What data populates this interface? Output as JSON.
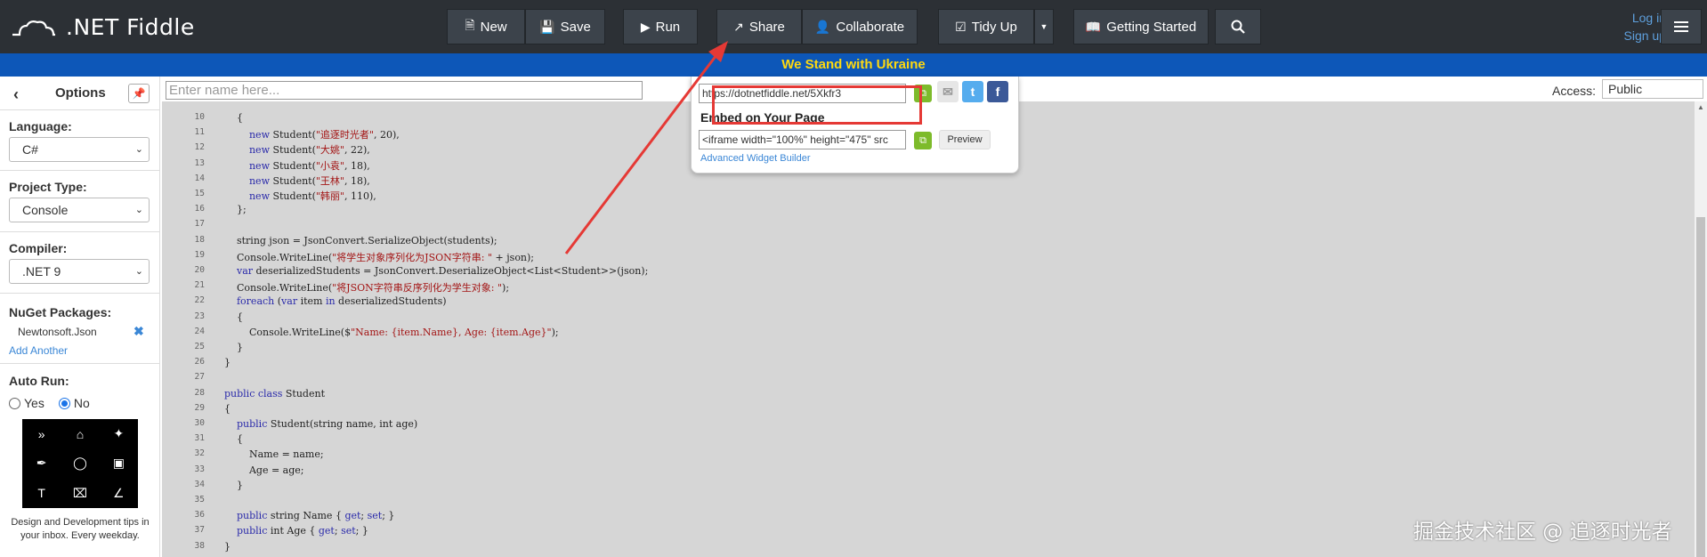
{
  "app": {
    "logo_text": ".NET Fiddle"
  },
  "toolbar": {
    "new_label": "New",
    "save_label": "Save",
    "run_label": "Run",
    "share_label": "Share",
    "collaborate_label": "Collaborate",
    "tidy_label": "Tidy Up",
    "getting_started_label": "Getting Started"
  },
  "auth": {
    "login": "Log in",
    "signup": "Sign up"
  },
  "banner": {
    "text": "We Stand with Ukraine"
  },
  "sidebar": {
    "title": "Options",
    "language_label": "Language:",
    "language_value": "C#",
    "project_type_label": "Project Type:",
    "project_type_value": "Console",
    "compiler_label": "Compiler:",
    "compiler_value": ".NET 9",
    "nuget_label": "NuGet Packages:",
    "nuget_items": [
      "Newtonsoft.Json"
    ],
    "add_another": "Add Another",
    "autorun_label": "Auto Run:",
    "autorun_yes": "Yes",
    "autorun_no": "No",
    "autorun_selected": "No",
    "ad_text": "Design and Development tips in your inbox. Every weekday."
  },
  "main": {
    "name_placeholder": "Enter name here...",
    "access_label": "Access:",
    "access_value": "Public"
  },
  "share": {
    "url": "https://dotnetfiddle.net/5Xkfr3",
    "embed_title": "Embed on Your Page",
    "embed_code": "<iframe width=\"100%\" height=\"475\" src",
    "preview_label": "Preview",
    "advanced_link": "Advanced Widget Builder"
  },
  "editor": {
    "lines": [
      {
        "n": "10",
        "segs": [
          {
            "t": "        {"
          }
        ]
      },
      {
        "n": "11",
        "segs": [
          {
            "t": "            "
          },
          {
            "t": "new",
            "k": "kw"
          },
          {
            "t": " Student("
          },
          {
            "t": "\"追逐时光者\"",
            "k": "str"
          },
          {
            "t": ", 20),"
          }
        ]
      },
      {
        "n": "12",
        "segs": [
          {
            "t": "            "
          },
          {
            "t": "new",
            "k": "kw"
          },
          {
            "t": " Student("
          },
          {
            "t": "\"大姚\"",
            "k": "str"
          },
          {
            "t": ", 22),"
          }
        ]
      },
      {
        "n": "13",
        "segs": [
          {
            "t": "            "
          },
          {
            "t": "new",
            "k": "kw"
          },
          {
            "t": " Student("
          },
          {
            "t": "\"小袁\"",
            "k": "str"
          },
          {
            "t": ", 18),"
          }
        ]
      },
      {
        "n": "14",
        "segs": [
          {
            "t": "            "
          },
          {
            "t": "new",
            "k": "kw"
          },
          {
            "t": " Student("
          },
          {
            "t": "\"王林\"",
            "k": "str"
          },
          {
            "t": ", 18),"
          }
        ]
      },
      {
        "n": "15",
        "segs": [
          {
            "t": "            "
          },
          {
            "t": "new",
            "k": "kw"
          },
          {
            "t": " Student("
          },
          {
            "t": "\"韩丽\"",
            "k": "str"
          },
          {
            "t": ", 110),"
          }
        ]
      },
      {
        "n": "16",
        "segs": [
          {
            "t": "        };"
          }
        ]
      },
      {
        "n": "17",
        "segs": [
          {
            "t": ""
          }
        ]
      },
      {
        "n": "18",
        "segs": [
          {
            "t": "        string json = JsonConvert.SerializeObject(students);"
          }
        ]
      },
      {
        "n": "19",
        "segs": [
          {
            "t": "        Console.WriteLine("
          },
          {
            "t": "\"将学生对象序列化为JSON字符串: \"",
            "k": "str"
          },
          {
            "t": " + json);"
          }
        ]
      },
      {
        "n": "20",
        "segs": [
          {
            "t": "        "
          },
          {
            "t": "var",
            "k": "kw"
          },
          {
            "t": " deserializedStudents = JsonConvert.DeserializeObject<List<Student>>(json);"
          }
        ]
      },
      {
        "n": "21",
        "segs": [
          {
            "t": "        Console.WriteLine("
          },
          {
            "t": "\"将JSON字符串反序列化为学生对象: \"",
            "k": "str"
          },
          {
            "t": ");"
          }
        ]
      },
      {
        "n": "22",
        "segs": [
          {
            "t": "        "
          },
          {
            "t": "foreach",
            "k": "kw"
          },
          {
            "t": " ("
          },
          {
            "t": "var",
            "k": "kw"
          },
          {
            "t": " item "
          },
          {
            "t": "in",
            "k": "kw"
          },
          {
            "t": " deserializedStudents)"
          }
        ]
      },
      {
        "n": "23",
        "segs": [
          {
            "t": "        {"
          }
        ]
      },
      {
        "n": "24",
        "segs": [
          {
            "t": "            Console.WriteLine($"
          },
          {
            "t": "\"Name: {item.Name}, Age: {item.Age}\"",
            "k": "str"
          },
          {
            "t": ");"
          }
        ]
      },
      {
        "n": "25",
        "segs": [
          {
            "t": "        }"
          }
        ]
      },
      {
        "n": "26",
        "segs": [
          {
            "t": "    }"
          }
        ]
      },
      {
        "n": "27",
        "segs": [
          {
            "t": ""
          }
        ]
      },
      {
        "n": "28",
        "segs": [
          {
            "t": "    "
          },
          {
            "t": "public class",
            "k": "kw"
          },
          {
            "t": " Student"
          }
        ]
      },
      {
        "n": "29",
        "segs": [
          {
            "t": "    {"
          }
        ]
      },
      {
        "n": "30",
        "segs": [
          {
            "t": "        "
          },
          {
            "t": "public",
            "k": "kw"
          },
          {
            "t": " Student(string name, int age)"
          }
        ]
      },
      {
        "n": "31",
        "segs": [
          {
            "t": "        {"
          }
        ]
      },
      {
        "n": "32",
        "segs": [
          {
            "t": "            Name = name;"
          }
        ]
      },
      {
        "n": "33",
        "segs": [
          {
            "t": "            Age = age;"
          }
        ]
      },
      {
        "n": "34",
        "segs": [
          {
            "t": "        }"
          }
        ]
      },
      {
        "n": "35",
        "segs": [
          {
            "t": ""
          }
        ]
      },
      {
        "n": "36",
        "segs": [
          {
            "t": "        "
          },
          {
            "t": "public",
            "k": "kw"
          },
          {
            "t": " string Name { "
          },
          {
            "t": "get",
            "k": "kw"
          },
          {
            "t": "; "
          },
          {
            "t": "set",
            "k": "kw"
          },
          {
            "t": "; }"
          }
        ]
      },
      {
        "n": "37",
        "segs": [
          {
            "t": "        "
          },
          {
            "t": "public",
            "k": "kw"
          },
          {
            "t": " int Age { "
          },
          {
            "t": "get",
            "k": "kw"
          },
          {
            "t": "; "
          },
          {
            "t": "set",
            "k": "kw"
          },
          {
            "t": "; }"
          }
        ]
      },
      {
        "n": "38",
        "segs": [
          {
            "t": "    }"
          }
        ]
      }
    ]
  },
  "watermark": {
    "text": "掘金技术社区 @ 追逐时光者"
  },
  "colors": {
    "topbar": "#2c3035",
    "banner_bg": "#0d57b8",
    "banner_text": "#ffd90f",
    "annotation_red": "#e53935",
    "copy_green": "#7dbb2b"
  }
}
